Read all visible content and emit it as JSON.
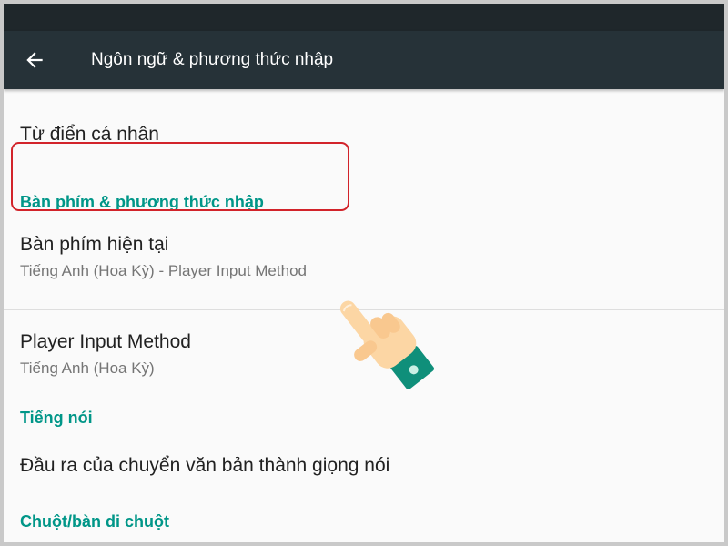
{
  "appbar": {
    "title": "Ngôn ngữ & phương thức nhập",
    "back_icon": "arrow-back-icon"
  },
  "items": [
    {
      "title": "Từ điển cá nhân"
    },
    {
      "category": "Bàn phím & phương thức nhập"
    },
    {
      "title": "Bàn phím hiện tại",
      "summary": "Tiếng Anh (Hoa Kỳ) - Player Input Method"
    },
    {
      "title": "Player Input Method",
      "summary": "Tiếng Anh (Hoa Kỳ)"
    },
    {
      "category": "Tiếng nói"
    },
    {
      "title": "Đầu ra của chuyển văn bản thành giọng nói"
    },
    {
      "category": "Chuột/bàn di chuột"
    }
  ],
  "annotations": {
    "highlight_color": "#d2232a",
    "pointer_icon": "pointing-hand-icon"
  },
  "colors": {
    "appbar": "#263238",
    "statusbar": "#1f272b",
    "accent": "#009688",
    "background": "#fafafa"
  }
}
